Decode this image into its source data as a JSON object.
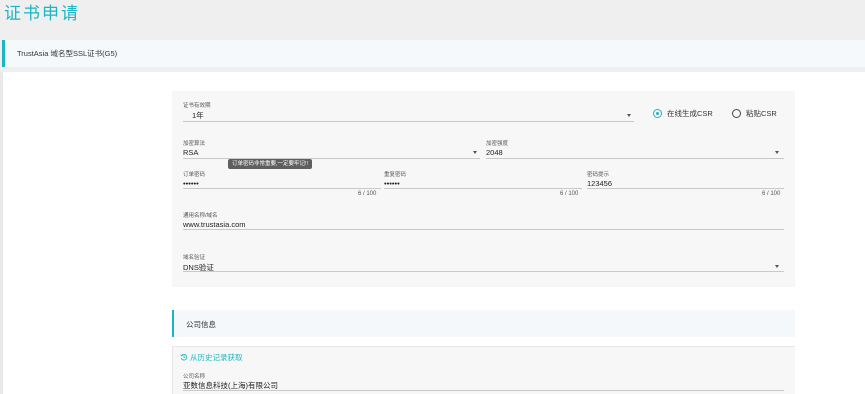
{
  "page": {
    "title": "证书申请"
  },
  "product": {
    "name": "TrustAsia 域名型SSL证书(G5)"
  },
  "validity": {
    "label": "证书有效期",
    "value": "1年"
  },
  "csr": {
    "options": [
      "在线生成CSR",
      "粘贴CSR"
    ],
    "selected": 0
  },
  "algorithm": {
    "label": "加密算法",
    "value": "RSA"
  },
  "strength": {
    "label": "加密强度",
    "value": "2048"
  },
  "order_password": {
    "label": "订单密码",
    "value": "••••••",
    "counter": "6 / 100",
    "tooltip": "订单密码非常重要,一定要牢记!!"
  },
  "repeat_password": {
    "label": "重复密码",
    "value": "••••••",
    "counter": "6 / 100"
  },
  "password_hint": {
    "label": "密码提示",
    "value": "123456",
    "counter": "6 / 100"
  },
  "common_name": {
    "label": "通用名称/域名",
    "value": "www.trustasia.com"
  },
  "domain_validation": {
    "label": "域名验证",
    "value": "DNS验证"
  },
  "company_section": {
    "title": "公司信息"
  },
  "history_link": {
    "icon": "history-icon",
    "label": "从历史记录获取"
  },
  "company_name": {
    "label": "公司名称",
    "value": "亚数信息科技(上海)有限公司"
  },
  "colors": {
    "accent": "#1cb5c2",
    "card_bg": "#f7f7f7",
    "header_bg": "#efefef"
  }
}
